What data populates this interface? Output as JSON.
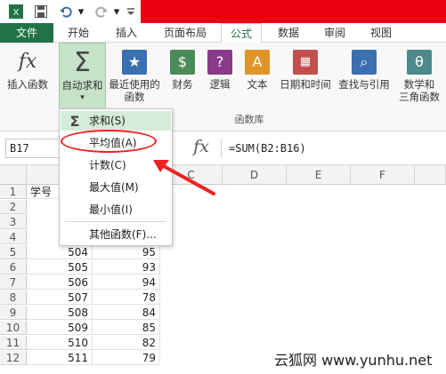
{
  "tabs": [
    "文件",
    "开始",
    "插入",
    "页面布局",
    "公式",
    "数据",
    "审阅",
    "视图"
  ],
  "ribbon": {
    "buttons": [
      {
        "label_1": "插入函数",
        "label_2": "",
        "icon": "fx-icon"
      },
      {
        "label_1": "自动求和",
        "label_2": "",
        "icon": "sigma-icon"
      },
      {
        "label_1": "最近使用的",
        "label_2": "函数",
        "icon": "star-icon"
      },
      {
        "label_1": "财务",
        "label_2": "",
        "icon": "coins-icon"
      },
      {
        "label_1": "逻辑",
        "label_2": "",
        "icon": "question-icon"
      },
      {
        "label_1": "文本",
        "label_2": "",
        "icon": "text-icon"
      },
      {
        "label_1": "日期和时间",
        "label_2": "",
        "icon": "calendar-icon"
      },
      {
        "label_1": "查找与引用",
        "label_2": "",
        "icon": "magnifier-icon"
      },
      {
        "label_1": "数学和",
        "label_2": "三角函数",
        "icon": "theta-icon"
      }
    ],
    "group_label": "函数库"
  },
  "formula_bar": {
    "name_box": "B17",
    "fx": "fx",
    "formula": "=SUM(B2:B16)"
  },
  "sheet": {
    "columns": [
      "C",
      "D",
      "E",
      "F"
    ],
    "row_numbers": [
      "1",
      "2",
      "3",
      "4",
      "5",
      "6",
      "7",
      "8",
      "9",
      "10",
      "11",
      "12"
    ],
    "a1": "学号",
    "rows": [
      {
        "a": "504",
        "b": "95"
      },
      {
        "a": "505",
        "b": "93"
      },
      {
        "a": "506",
        "b": "94"
      },
      {
        "a": "507",
        "b": "78"
      },
      {
        "a": "508",
        "b": "84"
      },
      {
        "a": "509",
        "b": "85"
      },
      {
        "a": "510",
        "b": "82"
      },
      {
        "a": "511",
        "b": "79"
      }
    ]
  },
  "autosum_menu": {
    "items": [
      "求和(S)",
      "平均值(A)",
      "计数(C)",
      "最大值(M)",
      "最小值(I)",
      "其他函数(F)..."
    ]
  },
  "watermark": "云狐网 www.yunhu.net",
  "colors": {
    "excel_green": "#217346",
    "annotation_red": "#e22222",
    "title_red": "#e8000f"
  }
}
